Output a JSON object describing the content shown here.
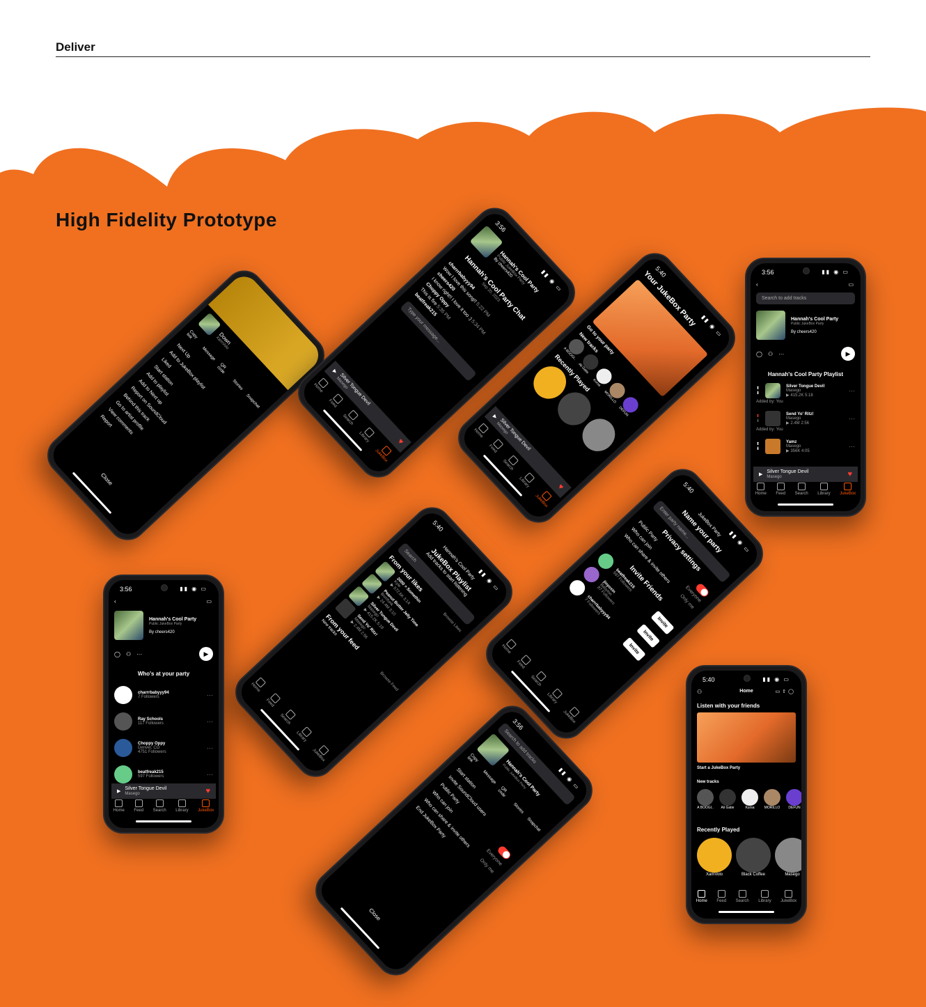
{
  "header": {
    "label": "Deliver",
    "title": "High Fidelity Prototype"
  },
  "colors": {
    "accent_orange": "#f07020",
    "screen_bg": "#000000",
    "heart": "#ff3b30"
  },
  "nav": [
    "Home",
    "Feed",
    "Search",
    "Library",
    "JukeBox"
  ],
  "party": {
    "name": "Hannah's Cool Party",
    "subtitle": "Public JukeBox Party",
    "host": "By cheers420",
    "playlist_title": "Hannah's Cool Party Playlist",
    "who_title": "Who's at your party",
    "search_placeholder": "Search to add tracks"
  },
  "now_playing": {
    "track": "Silver Tongue Devil",
    "artist": "Masego"
  },
  "phone_playlist": {
    "time": "3:56",
    "tracks": [
      {
        "title": "Silver Tongue Devil",
        "artist": "Masego",
        "meta": "▶ 415.2K  5:18",
        "added": "Added by: You"
      },
      {
        "title": "Send Yo' Ritz!",
        "artist": "Masego",
        "meta": "▶ 2.4M  2:56",
        "added": "Added by: You"
      },
      {
        "title": "Yamz",
        "artist": "Masego",
        "meta": "▶ 356K  4:05",
        "added": ""
      }
    ]
  },
  "phone_members": {
    "time": "3:56",
    "members": [
      {
        "name": "charrrbabyyy94",
        "line2": "",
        "followers": "7 Followers"
      },
      {
        "name": "Ray Schools",
        "line2": "",
        "followers": "117 Followers"
      },
      {
        "name": "Choppy Oppy",
        "line2": "Denver, CO",
        "followers": "4751 Followers"
      },
      {
        "name": "beatfreak215",
        "line2": "",
        "followers": "597 Followers"
      }
    ]
  },
  "phone_home": {
    "time": "5:40",
    "title": "Home",
    "listen_heading": "Listen with your friends",
    "start_party": "Start a JukeBox Party",
    "new_tracks": "New tracks",
    "artists": [
      "A BOOGI..",
      "Ali Gatie",
      "Kursa",
      "MORILLO",
      "DEFUN"
    ],
    "recently_played": "Recently Played",
    "recent": [
      "XamVolo",
      "Black Coffee",
      "Masego"
    ]
  },
  "phone_share": {
    "items": [
      "Next Up",
      "Add to JukeBox playlist",
      "Liked",
      "Start station",
      "Add to playlist",
      "Add to Next up",
      "Report on SoundCloud",
      "Behind this track",
      "Go to artist profile",
      "View comments",
      "Report"
    ],
    "share_targets": [
      "Copy link",
      "Message",
      "QR code",
      "Stories",
      "Snapchat"
    ],
    "track": "Down",
    "artist": "XamVolo",
    "close": "Close"
  },
  "phone_chat": {
    "time": "3:56",
    "title": "Hannah's Cool Party Chat",
    "date": "Sep 20, 2023",
    "messages": [
      {
        "user": "charrrbabyyy94",
        "text": "Wow I love this song!!",
        "time": "5:22 PM"
      },
      {
        "user": "cheers420",
        "text": "I know right!! I love it too :)",
        "time": "5:34 PM"
      },
      {
        "user": "Choppy Oppy",
        "text": "This is fire",
        "time": "5:35 PM"
      },
      {
        "user": "beatfreak215",
        "text": "",
        "time": ""
      }
    ],
    "placeholder": "Type your message..."
  },
  "phone_jukebox": {
    "time": "5:40",
    "title": "Your JukeBox Party",
    "go": "Go to your party",
    "new_tracks": "New tracks",
    "artists": [
      "A BOOGI..",
      "Ali Gatie",
      "Kursa",
      "MORILLO",
      "DEFUN"
    ],
    "recently_played": "Recently Played"
  },
  "phone_addtracks": {
    "time": "5:40",
    "header": "Hannah's Cool Party",
    "title": "JukeBox Playlist",
    "subtitle": "Add tracks to start listening",
    "search": "Search",
    "likes": "From your likes",
    "feed": "From your feed",
    "feed_sub": "New tracks",
    "browse": "Browse Likes",
    "browse_feed": "Browse Feed",
    "tracks": [
      {
        "title": "2000 > Somethin",
        "artist": "Kyle",
        "meta": "▶ 572.6K  3:14"
      },
      {
        "title": "Peanut Butter Jelly Time",
        "artist": "Bomfunk",
        "meta": "▶ 24.4M  3:10"
      },
      {
        "title": "Silver Tongue Devil",
        "artist": "Masego",
        "meta": "▶ 415.2K  5:18"
      },
      {
        "title": "Send Yo' Ritz!",
        "artist": "Masego",
        "meta": "▶ 2.4M  2:56"
      }
    ]
  },
  "phone_create": {
    "time": "5:40",
    "header": "JukeBox Party",
    "name_label": "Name your party",
    "name_placeholder": "Enter party name...",
    "privacy": "Privacy settings",
    "public": "Public Party",
    "who_join": "Who can join",
    "who_share": "Who can share & invite others",
    "everyone": "Everyone",
    "only_me": "Only me",
    "invite_title": "Invite Friends",
    "friends": [
      {
        "name": "beatfreak215",
        "followers": "597 Followers"
      },
      {
        "name": "jinyoxin",
        "line2": "Babylon",
        "followers": "87 Followers"
      },
      {
        "name": "charrrbabyyy94",
        "followers": "7 Followers"
      }
    ],
    "invite": "Invite"
  },
  "phone_settings": {
    "time": "3:56",
    "search": "Search to add tracks",
    "party": "Hannah's Cool Party",
    "sub": "Public JukeBox Party",
    "items": [
      "Start station",
      "Invite SoundCloud users",
      "Public Party",
      "Who can join",
      "Who can share & invite others",
      "End JukeBox Party"
    ],
    "everyone": "Everyone",
    "only_me": "Only me",
    "share_targets": [
      "Copy link",
      "Message",
      "QR code",
      "Stories",
      "Snapchat"
    ],
    "close": "Close"
  }
}
